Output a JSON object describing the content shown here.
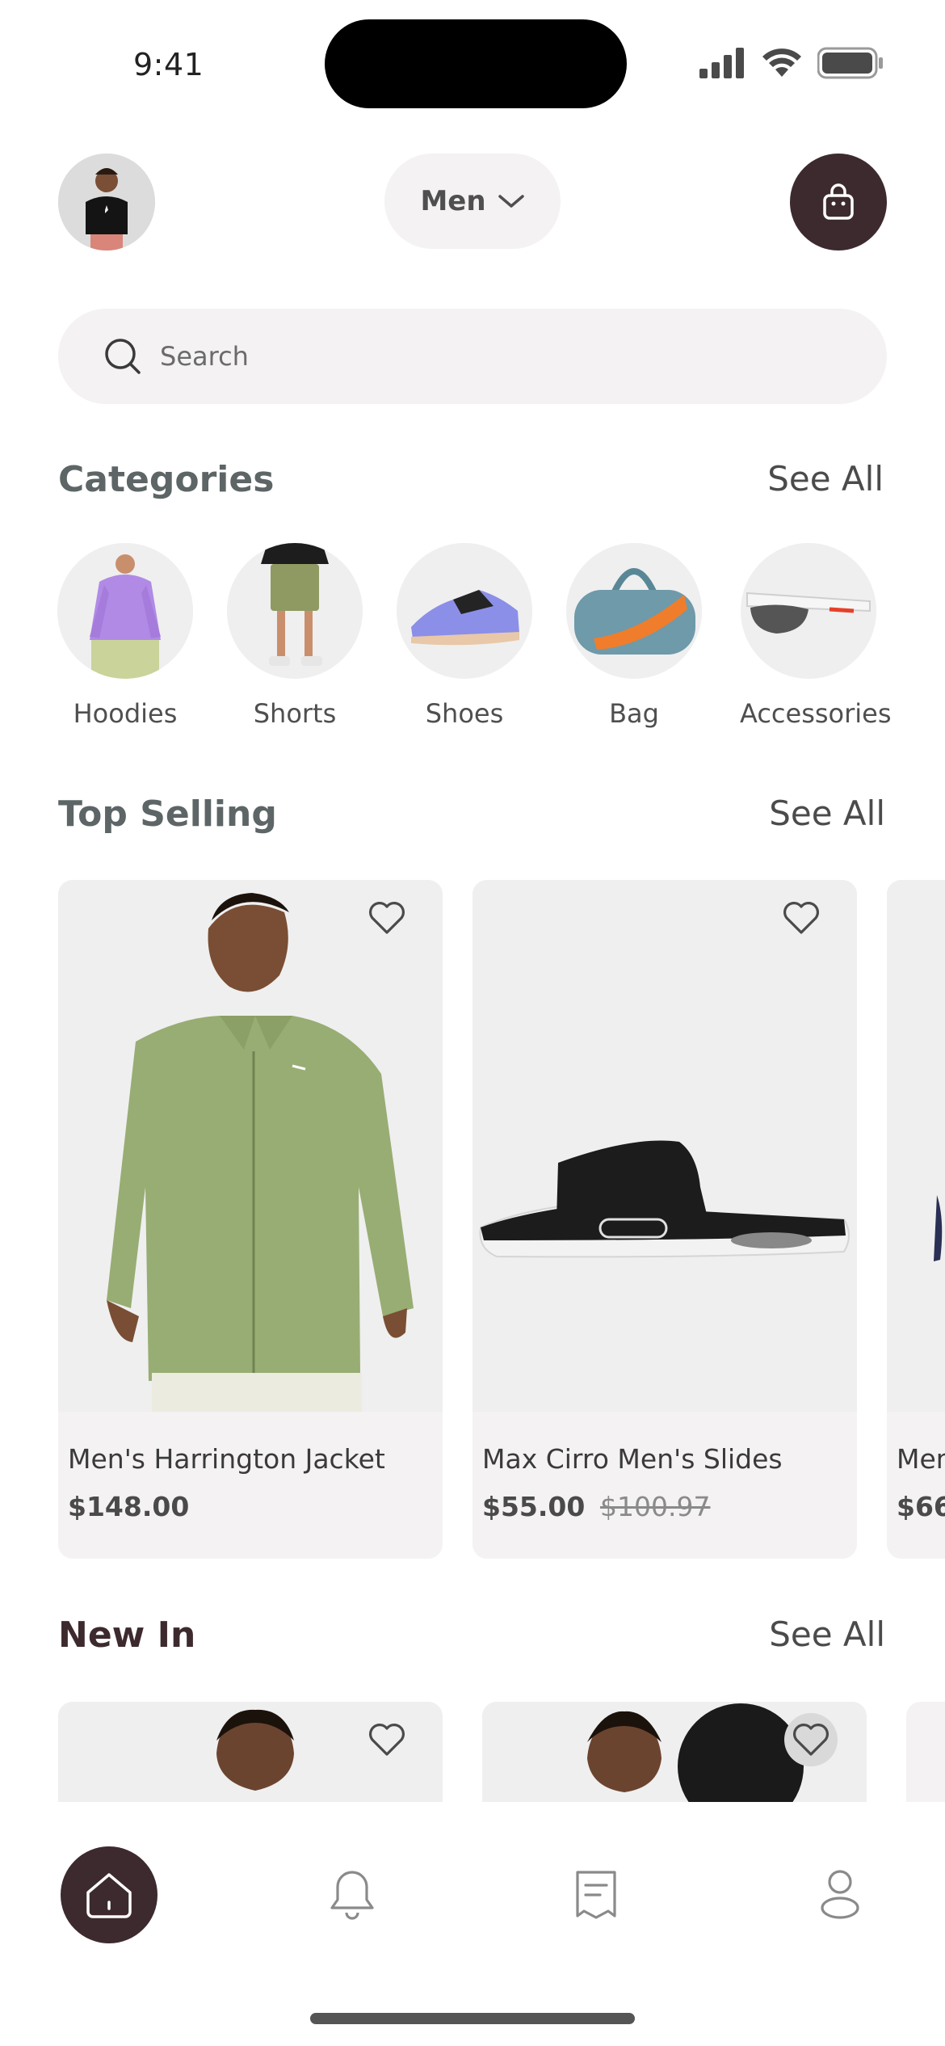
{
  "status": {
    "time": "9:41"
  },
  "header": {
    "gender_label": "Men"
  },
  "search": {
    "placeholder": "Search"
  },
  "categories": {
    "title": "Categories",
    "see_all": "See All",
    "items": [
      {
        "label": "Hoodies",
        "icon": "hoodie-image"
      },
      {
        "label": "Shorts",
        "icon": "shorts-image"
      },
      {
        "label": "Shoes",
        "icon": "shoe-image"
      },
      {
        "label": "Bag",
        "icon": "bag-image"
      },
      {
        "label": "Accessories",
        "icon": "sunglasses-image"
      }
    ]
  },
  "top_selling": {
    "title": "Top Selling",
    "see_all": "See All",
    "products": [
      {
        "name": "Men's Harrington Jacket",
        "price": "$148.00",
        "old_price": ""
      },
      {
        "name": "Max Cirro Men's Slides",
        "price": "$55.00",
        "old_price": "$100.97"
      },
      {
        "name": "Men",
        "price": "$66",
        "old_price": ""
      }
    ]
  },
  "new_in": {
    "title": "New In",
    "see_all": "See All"
  },
  "tabbar": {
    "items": [
      "home-icon",
      "bell-icon",
      "receipt-icon",
      "profile-icon"
    ]
  },
  "colors": {
    "accent": "#3d2a2e",
    "surface": "#f4f2f2",
    "title_dark": "#3d2a2e",
    "title_grey": "#5d6566"
  }
}
